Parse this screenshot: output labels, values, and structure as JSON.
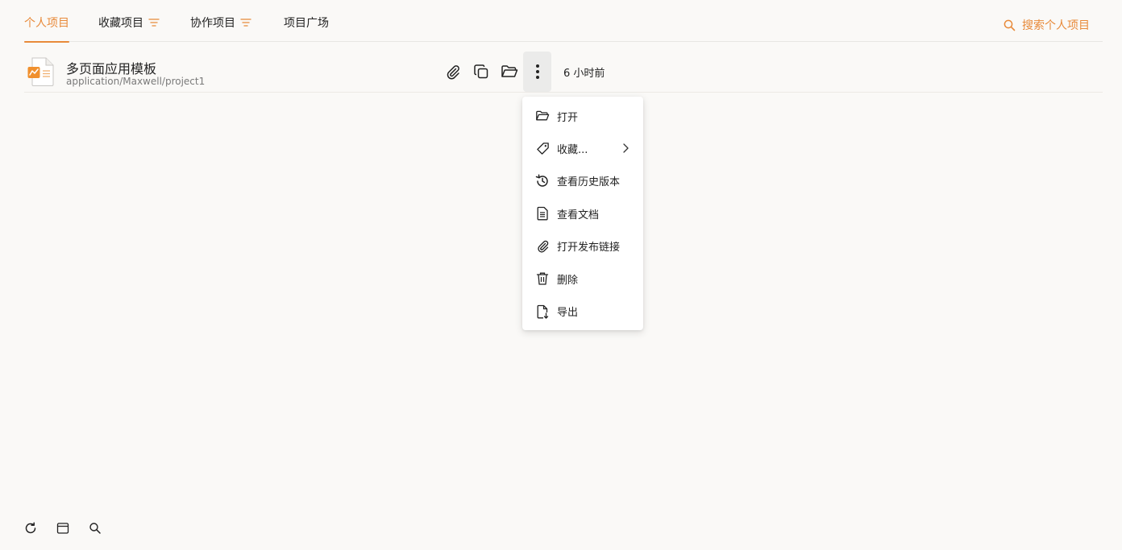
{
  "colors": {
    "accent": "#e88a3a",
    "background": "#faf9f7",
    "text": "#222222",
    "muted": "#7a7a7a"
  },
  "tabs": [
    {
      "label": "个人项目",
      "active": true,
      "has_filter": false
    },
    {
      "label": "收藏项目",
      "active": false,
      "has_filter": true
    },
    {
      "label": "协作项目",
      "active": false,
      "has_filter": true
    },
    {
      "label": "项目广场",
      "active": false,
      "has_filter": false
    }
  ],
  "search": {
    "label": "搜索个人项目",
    "icon": "search-icon"
  },
  "project": {
    "title": "多页面应用模板",
    "path": "application/Maxwell/project1",
    "time": "6 小时前",
    "actions": [
      {
        "icon": "paperclip-icon"
      },
      {
        "icon": "copy-icon"
      },
      {
        "icon": "folder-open-icon"
      },
      {
        "icon": "more-vertical-icon"
      }
    ]
  },
  "context_menu": {
    "items": [
      {
        "label": "打开",
        "icon": "folder-open-icon"
      },
      {
        "label": "收藏...",
        "icon": "tag-icon",
        "has_submenu": true
      },
      {
        "label": "查看历史版本",
        "icon": "history-icon"
      },
      {
        "label": "查看文档",
        "icon": "document-icon"
      },
      {
        "label": "打开发布链接",
        "icon": "paperclip-icon"
      },
      {
        "label": "删除",
        "icon": "trash-icon"
      },
      {
        "label": "导出",
        "icon": "export-file-icon"
      }
    ]
  },
  "bottom_toolbar": [
    {
      "icon": "refresh-icon"
    },
    {
      "icon": "window-icon"
    },
    {
      "icon": "search-icon"
    }
  ]
}
